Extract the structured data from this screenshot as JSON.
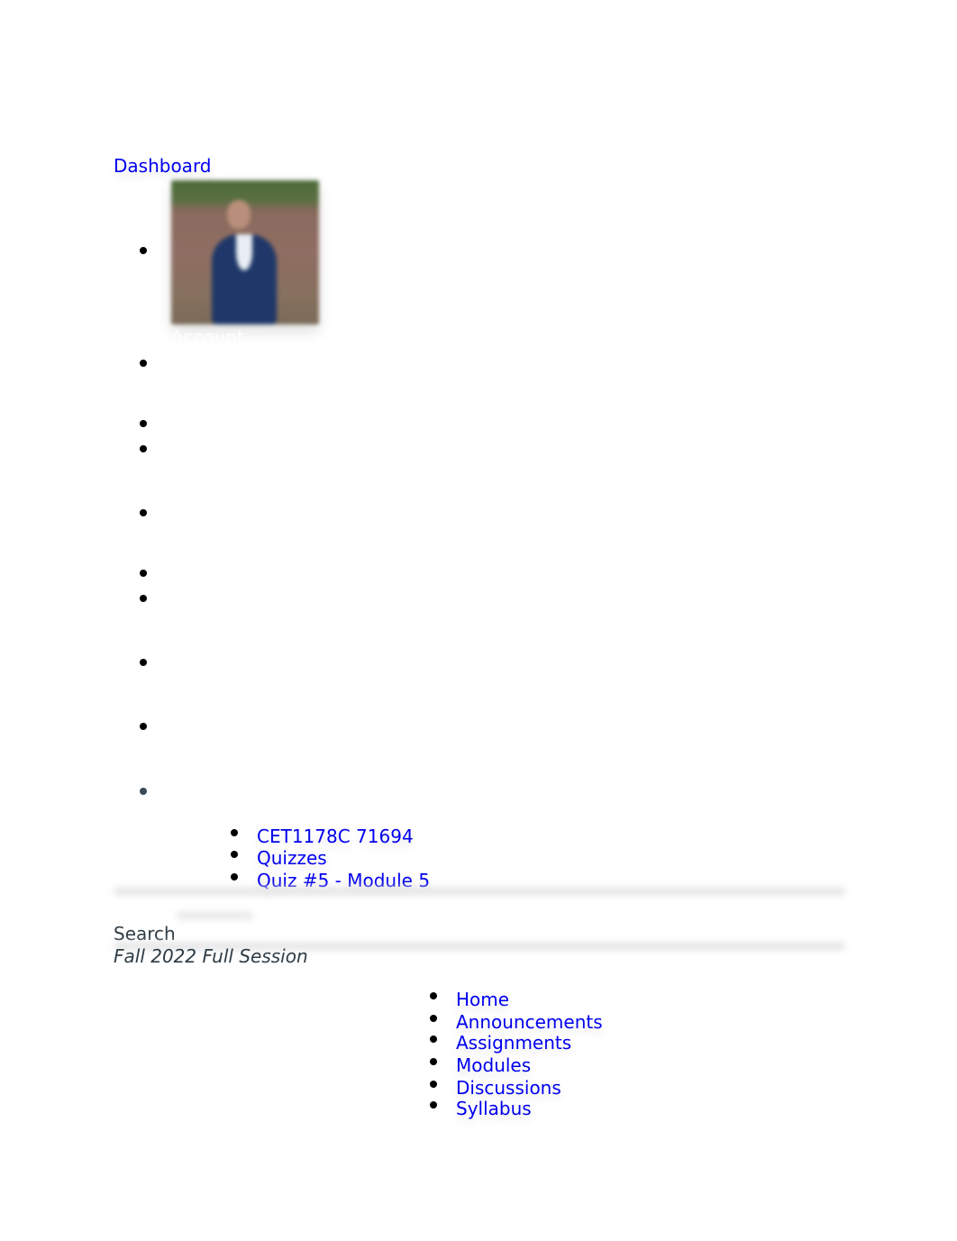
{
  "header": {
    "dashboard_link": "Dashboard"
  },
  "global_nav": {
    "account_label": "Account",
    "items": [
      {
        "name": "account",
        "bullet_color": "#000000"
      },
      {
        "name": "item-2",
        "bullet_color": "#000000"
      },
      {
        "name": "item-3",
        "bullet_color": "#000000"
      },
      {
        "name": "item-4",
        "bullet_color": "#000000"
      },
      {
        "name": "item-5",
        "bullet_color": "#000000"
      },
      {
        "name": "item-6",
        "bullet_color": "#000000"
      },
      {
        "name": "item-7",
        "bullet_color": "#000000"
      },
      {
        "name": "item-8",
        "bullet_color": "#000000"
      },
      {
        "name": "item-9",
        "bullet_color": "#000000"
      },
      {
        "name": "item-10",
        "bullet_color": "#394b58"
      }
    ]
  },
  "breadcrumbs": [
    {
      "label": "CET1178C 71694"
    },
    {
      "label": "Quizzes"
    },
    {
      "label": "Quiz #5 - Module 5"
    }
  ],
  "search": {
    "label": "Search"
  },
  "term": {
    "label": "Fall 2022 Full Session"
  },
  "course_nav": [
    {
      "label": "Home"
    },
    {
      "label": "Announcements"
    },
    {
      "label": "Assignments"
    },
    {
      "label": "Modules"
    },
    {
      "label": "Discussions"
    },
    {
      "label": "Syllabus"
    }
  ],
  "colors": {
    "link": "#0000ee",
    "text_dark": "#2d3b45"
  }
}
